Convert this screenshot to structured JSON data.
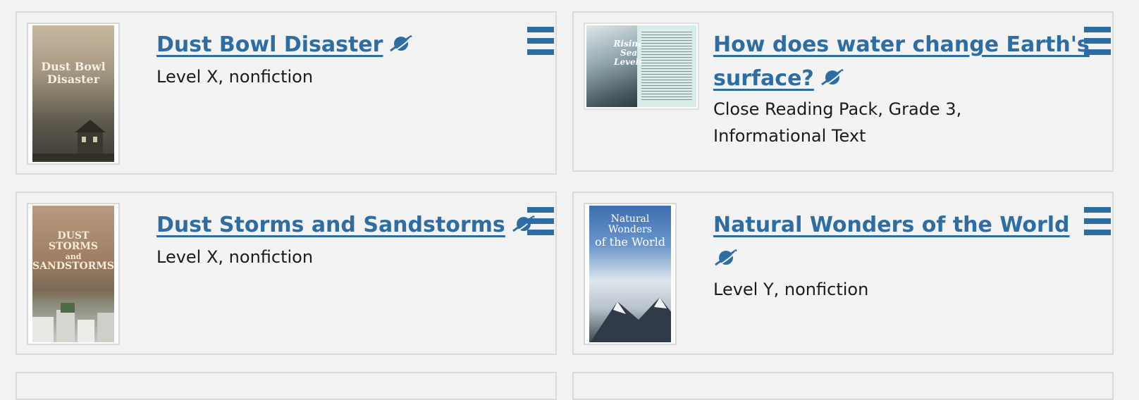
{
  "cards": [
    {
      "title": "Dust Bowl Disaster",
      "subtitle_line1": "Level X, nonfiction",
      "cover_text": [
        "Dust Bowl",
        "Disaster"
      ],
      "icon": "planet-icon",
      "menu_icon": "hamburger-menu-icon"
    },
    {
      "title_line1": "How does water change Earth's",
      "title_line2": "surface?",
      "subtitle_line1": "Close Reading Pack, Grade 3,",
      "subtitle_line2": "Informational Text",
      "cover_text": [
        "Rising",
        "Sea",
        "Levels"
      ],
      "icon": "planet-icon",
      "menu_icon": "hamburger-menu-icon"
    },
    {
      "title": "Dust Storms and Sandstorms",
      "subtitle_line1": "Level X, nonfiction",
      "cover_text": [
        "DUST STORMS",
        "and",
        "SANDSTORMS"
      ],
      "icon": "planet-icon",
      "menu_icon": "hamburger-menu-icon"
    },
    {
      "title": "Natural Wonders of the World",
      "subtitle_line1": "Level Y, nonfiction",
      "cover_text": [
        "Natural Wonders",
        "of the World"
      ],
      "icon": "planet-icon",
      "menu_icon": "hamburger-menu-icon"
    }
  ],
  "colors": {
    "link": "#2e6da4",
    "text": "#1b1b1b",
    "background": "#f3f3f3",
    "border": "#dadada"
  }
}
